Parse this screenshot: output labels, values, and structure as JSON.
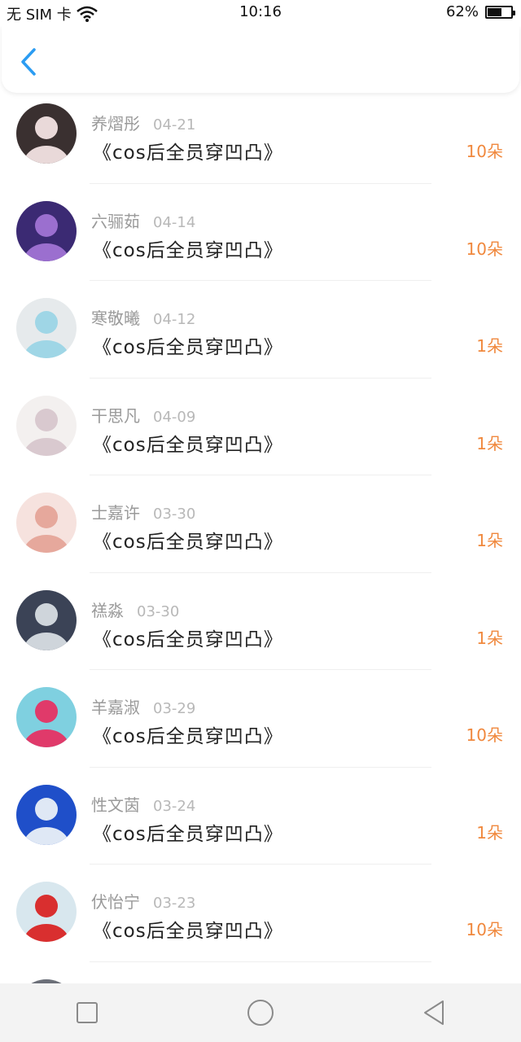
{
  "status": {
    "sim": "无 SIM 卡",
    "time": "10:16",
    "battery_text": "62%",
    "battery_level": 0.62
  },
  "header": {
    "back_icon": "chevron-left-icon",
    "accent": "#2b9cf2"
  },
  "list": {
    "amount_color": "#f0883d",
    "items": [
      {
        "name": "养熠彤",
        "date": "04-21",
        "title": "《cos后全员穿凹凸》",
        "amount": "10朵",
        "avatar": [
          "#3a3030",
          "#e9d9d9"
        ]
      },
      {
        "name": "六骊茹",
        "date": "04-14",
        "title": "《cos后全员穿凹凸》",
        "amount": "10朵",
        "avatar": [
          "#3b2a73",
          "#9b6fcf"
        ]
      },
      {
        "name": "寒敬曦",
        "date": "04-12",
        "title": "《cos后全员穿凹凸》",
        "amount": "1朵",
        "avatar": [
          "#e6eaec",
          "#9fd6e6"
        ]
      },
      {
        "name": "干思凡",
        "date": "04-09",
        "title": "《cos后全员穿凹凸》",
        "amount": "1朵",
        "avatar": [
          "#f3f0ef",
          "#d9c9cf"
        ]
      },
      {
        "name": "士嘉许",
        "date": "03-30",
        "title": "《cos后全员穿凹凸》",
        "amount": "1朵",
        "avatar": [
          "#f6e2de",
          "#e6a89c"
        ]
      },
      {
        "name": "禚淼",
        "date": "03-30",
        "title": "《cos后全员穿凹凸》",
        "amount": "1朵",
        "avatar": [
          "#3b4356",
          "#cfd5db"
        ]
      },
      {
        "name": "羊嘉淑",
        "date": "03-29",
        "title": "《cos后全员穿凹凸》",
        "amount": "10朵",
        "avatar": [
          "#7fd0e0",
          "#e03a6a"
        ]
      },
      {
        "name": "性文茵",
        "date": "03-24",
        "title": "《cos后全员穿凹凸》",
        "amount": "1朵",
        "avatar": [
          "#1f4fc9",
          "#dfe8f5"
        ]
      },
      {
        "name": "伏怡宁",
        "date": "03-23",
        "title": "《cos后全员穿凹凸》",
        "amount": "10朵",
        "avatar": [
          "#d8e7ee",
          "#d92f2f"
        ]
      }
    ]
  },
  "navbar": {
    "square_icon": "square-icon",
    "home_icon": "circle-home-icon",
    "back_icon": "triangle-back-icon"
  }
}
